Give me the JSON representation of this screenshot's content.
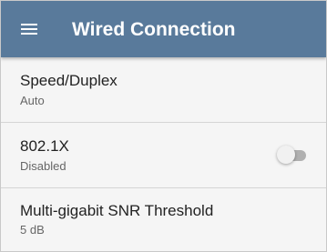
{
  "app_bar": {
    "title": "Wired Connection",
    "menu_icon": "hamburger-menu-icon",
    "background": "#597a9b",
    "text_color": "#ffffff"
  },
  "settings": [
    {
      "title": "Speed/Duplex",
      "value": "Auto"
    },
    {
      "title": "802.1X",
      "value": "Disabled",
      "toggle_state": "off"
    },
    {
      "title": "Multi-gigabit SNR Threshold",
      "value": "5 dB"
    }
  ],
  "colors": {
    "list_background": "#f5f5f5",
    "divider": "#d5d5d5",
    "toggle_off_track": "#b0b0b0",
    "toggle_thumb": "#f1f1f1"
  }
}
